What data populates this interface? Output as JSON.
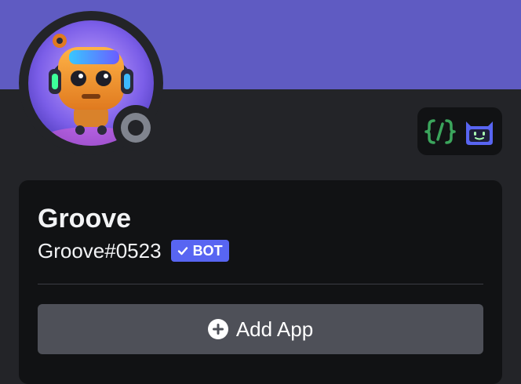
{
  "colors": {
    "banner": "#5f5bc2",
    "background": "#232428",
    "card": "#111214",
    "bot_tag": "#5865f2",
    "button": "#4e5058",
    "status_offline": "#80848e"
  },
  "profile": {
    "display_name": "Groove",
    "username": "Groove#0523",
    "bot_tag_label": "BOT",
    "status": "offline"
  },
  "badges": [
    {
      "icon": "code-brackets-icon"
    },
    {
      "icon": "bot-face-icon"
    }
  ],
  "actions": {
    "add_app_label": "Add App",
    "add_app_icon": "plus-circle-icon"
  }
}
